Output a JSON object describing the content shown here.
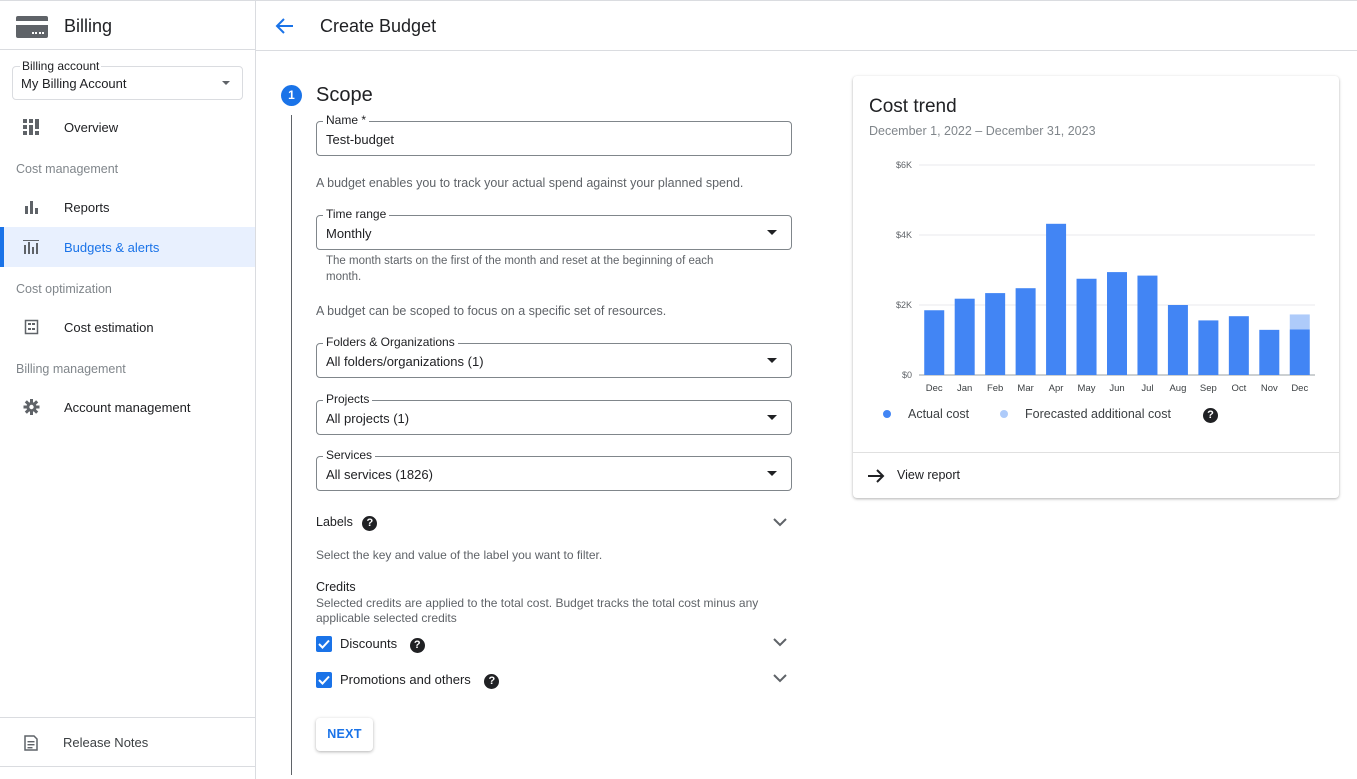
{
  "sidebar": {
    "title": "Billing",
    "billing_account": {
      "legend": "Billing account",
      "value": "My Billing Account"
    },
    "items": [
      {
        "label": "Overview"
      },
      {
        "section": "Cost management"
      },
      {
        "label": "Reports"
      },
      {
        "label": "Budgets & alerts",
        "active": true
      },
      {
        "section": "Cost optimization"
      },
      {
        "label": "Cost estimation"
      },
      {
        "section": "Billing management"
      },
      {
        "label": "Account management"
      }
    ],
    "footer_label": "Release Notes"
  },
  "header": {
    "title": "Create Budget"
  },
  "form": {
    "step_number": "1",
    "step_title": "Scope",
    "name": {
      "legend": "Name *",
      "value": "Test-budget"
    },
    "budget_help": "A budget enables you to track your actual spend against your planned spend.",
    "time_range": {
      "legend": "Time range",
      "value": "Monthly",
      "hint": "The month starts on the first of the month and reset at the beginning of each month."
    },
    "scope_help": "A budget can be scoped to focus on a specific set of resources.",
    "folders": {
      "legend": "Folders & Organizations",
      "value": "All folders/organizations (1)"
    },
    "projects": {
      "legend": "Projects",
      "value": "All projects (1)"
    },
    "services": {
      "legend": "Services",
      "value": "All services (1826)"
    },
    "labels": {
      "title": "Labels",
      "help": "Select the key and value of the label you want to filter."
    },
    "credits": {
      "title": "Credits",
      "help": "Selected credits are applied to the total cost. Budget tracks the total cost minus any applicable selected credits",
      "discounts": {
        "label": "Discounts",
        "checked": true
      },
      "promotions": {
        "label": "Promotions and others",
        "checked": true
      }
    },
    "next_label": "NEXT"
  },
  "card": {
    "title": "Cost trend",
    "subtitle": "December 1, 2022 – December 31, 2023",
    "legend_actual": "Actual cost",
    "legend_forecast": "Forecasted additional cost",
    "view_report": "View report"
  },
  "colors": {
    "accent": "#1a73e8",
    "actual": "#4285f4",
    "forecast": "#aecbfa"
  },
  "chart_data": {
    "type": "bar",
    "categories": [
      "Dec",
      "Jan",
      "Feb",
      "Mar",
      "Apr",
      "May",
      "Jun",
      "Jul",
      "Aug",
      "Sep",
      "Oct",
      "Nov",
      "Dec"
    ],
    "series": [
      {
        "name": "Actual cost",
        "values": [
          1850,
          2180,
          2340,
          2480,
          4320,
          2750,
          2940,
          2840,
          2000,
          1560,
          1680,
          1290,
          1300
        ]
      },
      {
        "name": "Forecasted additional cost",
        "values": [
          0,
          0,
          0,
          0,
          0,
          0,
          0,
          0,
          0,
          0,
          0,
          0,
          430
        ]
      }
    ],
    "yticks": [
      "$0",
      "$2K",
      "$4K",
      "$6K"
    ],
    "ylim": [
      0,
      6000
    ],
    "stacked": true,
    "grid": true,
    "legend_position": "bottom"
  }
}
